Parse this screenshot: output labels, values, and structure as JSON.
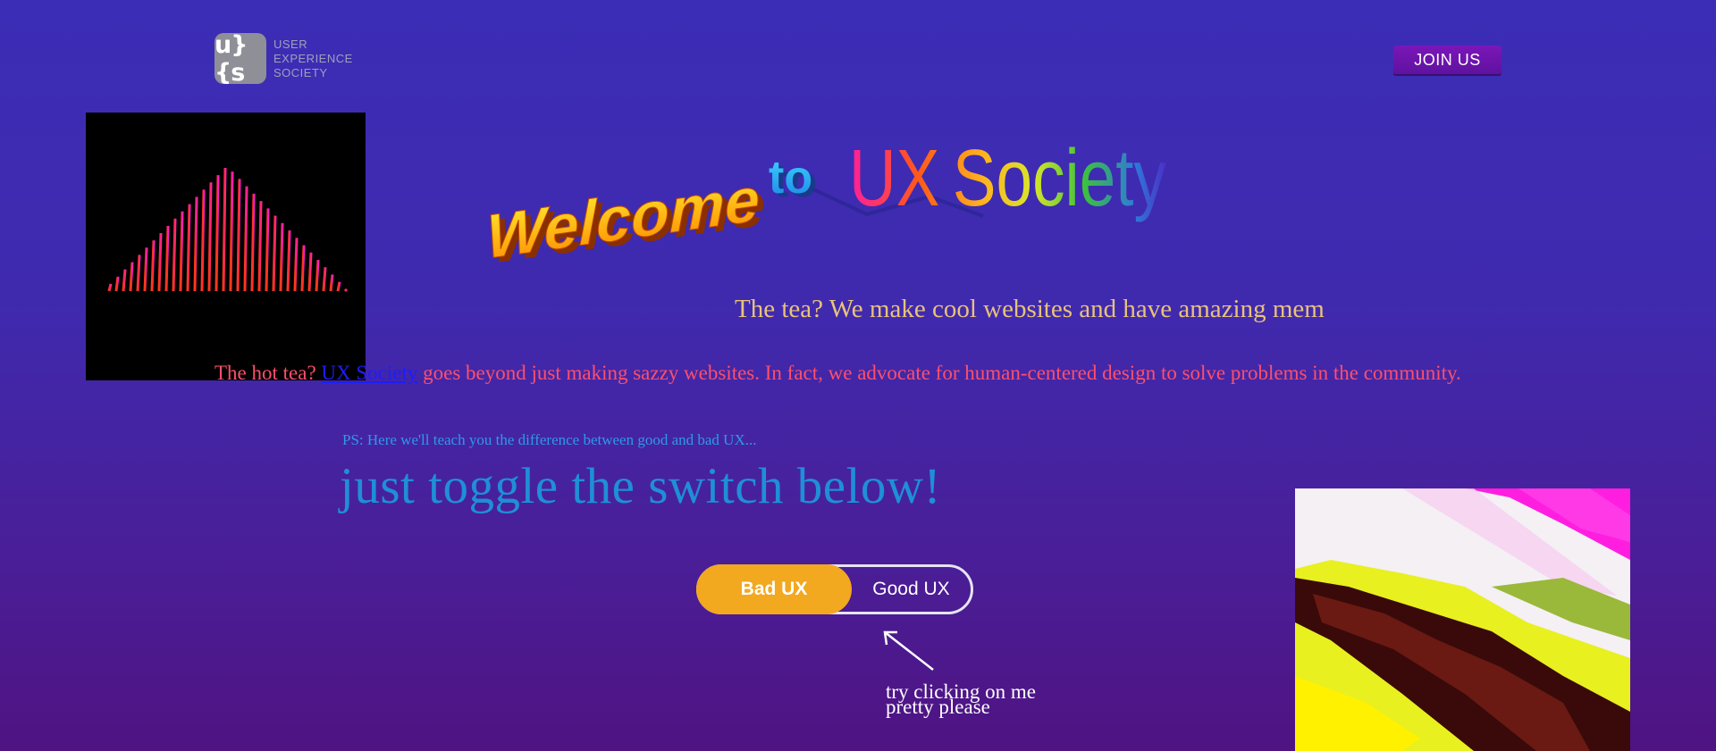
{
  "header": {
    "logo_mark": "u}{s",
    "logo_lines": [
      "USER",
      "EXPERIENCE",
      "SOCIETY"
    ],
    "join_label": "JOIN US"
  },
  "hero": {
    "word_welcome": "Welcome",
    "word_to": "to",
    "word_ux": "UX",
    "word_society": "Society"
  },
  "content": {
    "tea_line": "The tea? We make cool websites and have amazing mem",
    "hot_tea_prefix": "The hot tea? ",
    "hot_tea_link": "UX Society",
    "hot_tea_suffix": " goes beyond just making sazzy websites. In fact, we advocate for human-centered design to solve problems in the community.",
    "ps_note": "PS: Here we'll teach you the difference between good and bad UX...",
    "toggle_prompt": "just toggle the switch below!"
  },
  "toggle": {
    "option_bad": "Bad UX",
    "option_good": "Good UX",
    "selected": "Bad UX"
  },
  "hint": {
    "line1": "try clicking on me",
    "line2": "pretty please"
  },
  "colors": {
    "background_top": "#3c2db6",
    "background_bottom": "#4f1382",
    "toggle_active": "#f2a81f",
    "tea_text": "#e9c27a",
    "hot_tea_text": "#ff4f6a",
    "link": "#1d1dff",
    "blue_text": "#1f8fd6"
  }
}
